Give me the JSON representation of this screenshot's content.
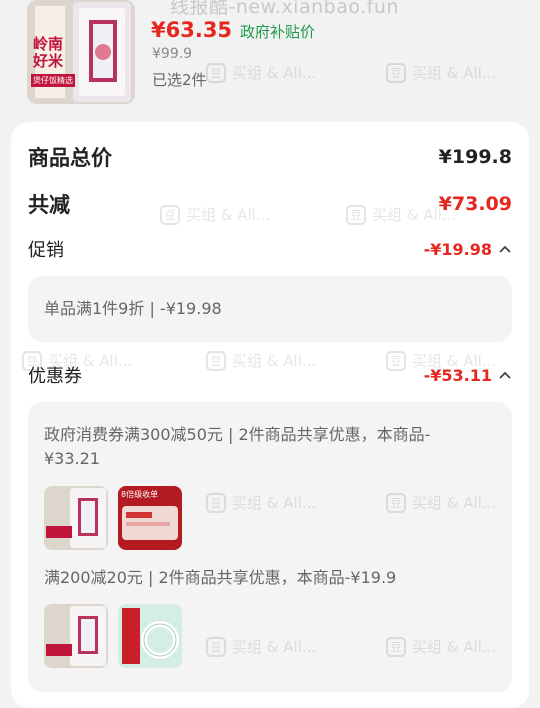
{
  "watermark_top": "线报酷-new.xianbao.fun",
  "watermark_repeat": "买组 & All...",
  "product": {
    "price_now": "¥63.35",
    "subsidy_label": "政府补贴价",
    "price_old": "¥99.9",
    "selected": "已选2件",
    "thumb_text_1": "岭南",
    "thumb_text_2": "好米",
    "thumb_text_3": "煲仔饭精选"
  },
  "summary": {
    "total_label": "商品总价",
    "total_value": "¥199.8",
    "reduce_label": "共减",
    "reduce_value": "¥73.09",
    "promo_label": "促销",
    "promo_value": "-¥19.98",
    "promo_detail": "单品满1件9折 | -¥19.98",
    "coupon_label": "优惠券",
    "coupon_value": "-¥53.11",
    "coupon1_text": "政府消费券满300减50元 | 2件商品共享优惠，本商品-¥33.21",
    "coupon2_text": "满200减20元 | 2件商品共享优惠，本商品-¥19.9",
    "promo_thumb_caption": "8倍级收单"
  },
  "colors": {
    "accent_red": "#e5271f",
    "green": "#1f9a4a"
  }
}
